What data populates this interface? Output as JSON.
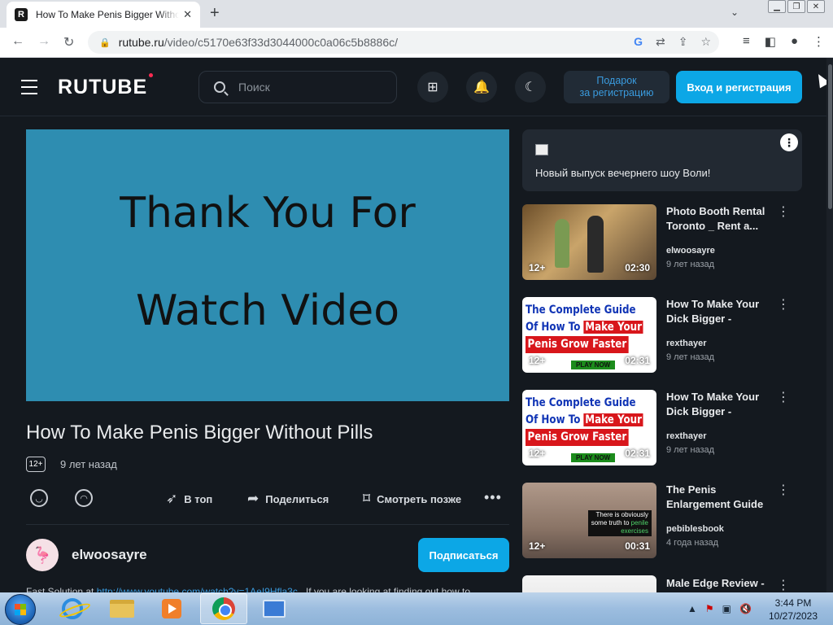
{
  "browser": {
    "tab_title": "How To Make Penis Bigger Witho",
    "tab_favicon": "R",
    "url_host": "rutube.ru",
    "url_path": "/video/c5170e63f33d3044000c0a06c5b8886c/"
  },
  "header": {
    "logo": "RUTUBE",
    "search_placeholder": "Поиск",
    "gift_line1": "Подарок",
    "gift_line2": "за регистрацию",
    "login_label": "Вход и регистрация"
  },
  "video": {
    "frame_line1": "Thank You For",
    "frame_line2": "Watch Video",
    "title": "How To Make Penis Bigger Without Pills",
    "age": "12+",
    "date": "9 лет назад",
    "top_label": "В топ",
    "share_label": "Поделиться",
    "later_label": "Смотреть позже",
    "channel": "elwoosayre",
    "subscribe_label": "Подписаться",
    "description": "Fast Solution at ",
    "description_link": "http://www.youtube.com/watch?v=1AeI9Hfla3c",
    "description_rest": " . If you are looking at finding out how to"
  },
  "ad": {
    "text": "Новый выпуск вечернего шоу Воли!"
  },
  "recommendations": [
    {
      "title": "Photo Booth Rental Toronto _ Rent a...",
      "channel": "elwoosayre",
      "date": "9 лет назад",
      "age": "12+",
      "duration": "02:30"
    },
    {
      "title": "How To Make Your Dick Bigger - Prove...",
      "channel": "rexthayer",
      "date": "9 лет назад",
      "age": "12+",
      "duration": "02:31"
    },
    {
      "title": "How To Make Your Dick Bigger - Prove...",
      "channel": "rexthayer",
      "date": "9 лет назад",
      "age": "12+",
      "duration": "02:31"
    },
    {
      "title": "The Penis Enlargement Guide",
      "channel": "pebiblesbook",
      "date": "4 года назад",
      "age": "12+",
      "duration": "00:31"
    },
    {
      "title": "Male Edge Review -"
    }
  ],
  "thumb_text": {
    "guide1": "The Complete Guide",
    "guide2": "Of How To",
    "guide2b": "Make Your",
    "guide3": "Penis Grow Faster",
    "play": "PLAY NOW",
    "pen1": "There is obviously",
    "pen2": "some truth to",
    "pen2b": "penile",
    "pen3": "exercises"
  },
  "taskbar": {
    "time": "3:44 PM",
    "date": "10/27/2023"
  },
  "colors": {
    "accent": "#0ca7e6",
    "background": "#14191f",
    "player": "#2e8db1"
  }
}
